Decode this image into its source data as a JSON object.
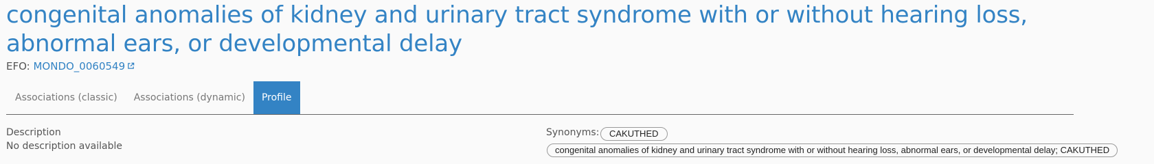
{
  "header": {
    "title_line1": "congenital anomalies of kidney and urinary tract syndrome with or without hearing loss,",
    "title_line2": "abnormal ears, or developmental delay",
    "efo_prefix": "EFO:",
    "efo_id": "MONDO_0060549",
    "efo_icon": "external-link-icon"
  },
  "tabs": [
    {
      "label": "Associations (classic)",
      "active": false
    },
    {
      "label": "Associations (dynamic)",
      "active": false
    },
    {
      "label": "Profile",
      "active": true
    }
  ],
  "profile": {
    "description_label": "Description",
    "description_text": "No description available",
    "synonyms_label": "Synonyms:",
    "synonyms": [
      "CAKUTHED",
      "congenital anomalies of kidney and urinary tract syndrome with or without hearing loss, abnormal ears, or developmental delay; CAKUTHED"
    ]
  },
  "colors": {
    "accent": "#3383c4",
    "text": "#555555",
    "background": "#fafafa"
  }
}
